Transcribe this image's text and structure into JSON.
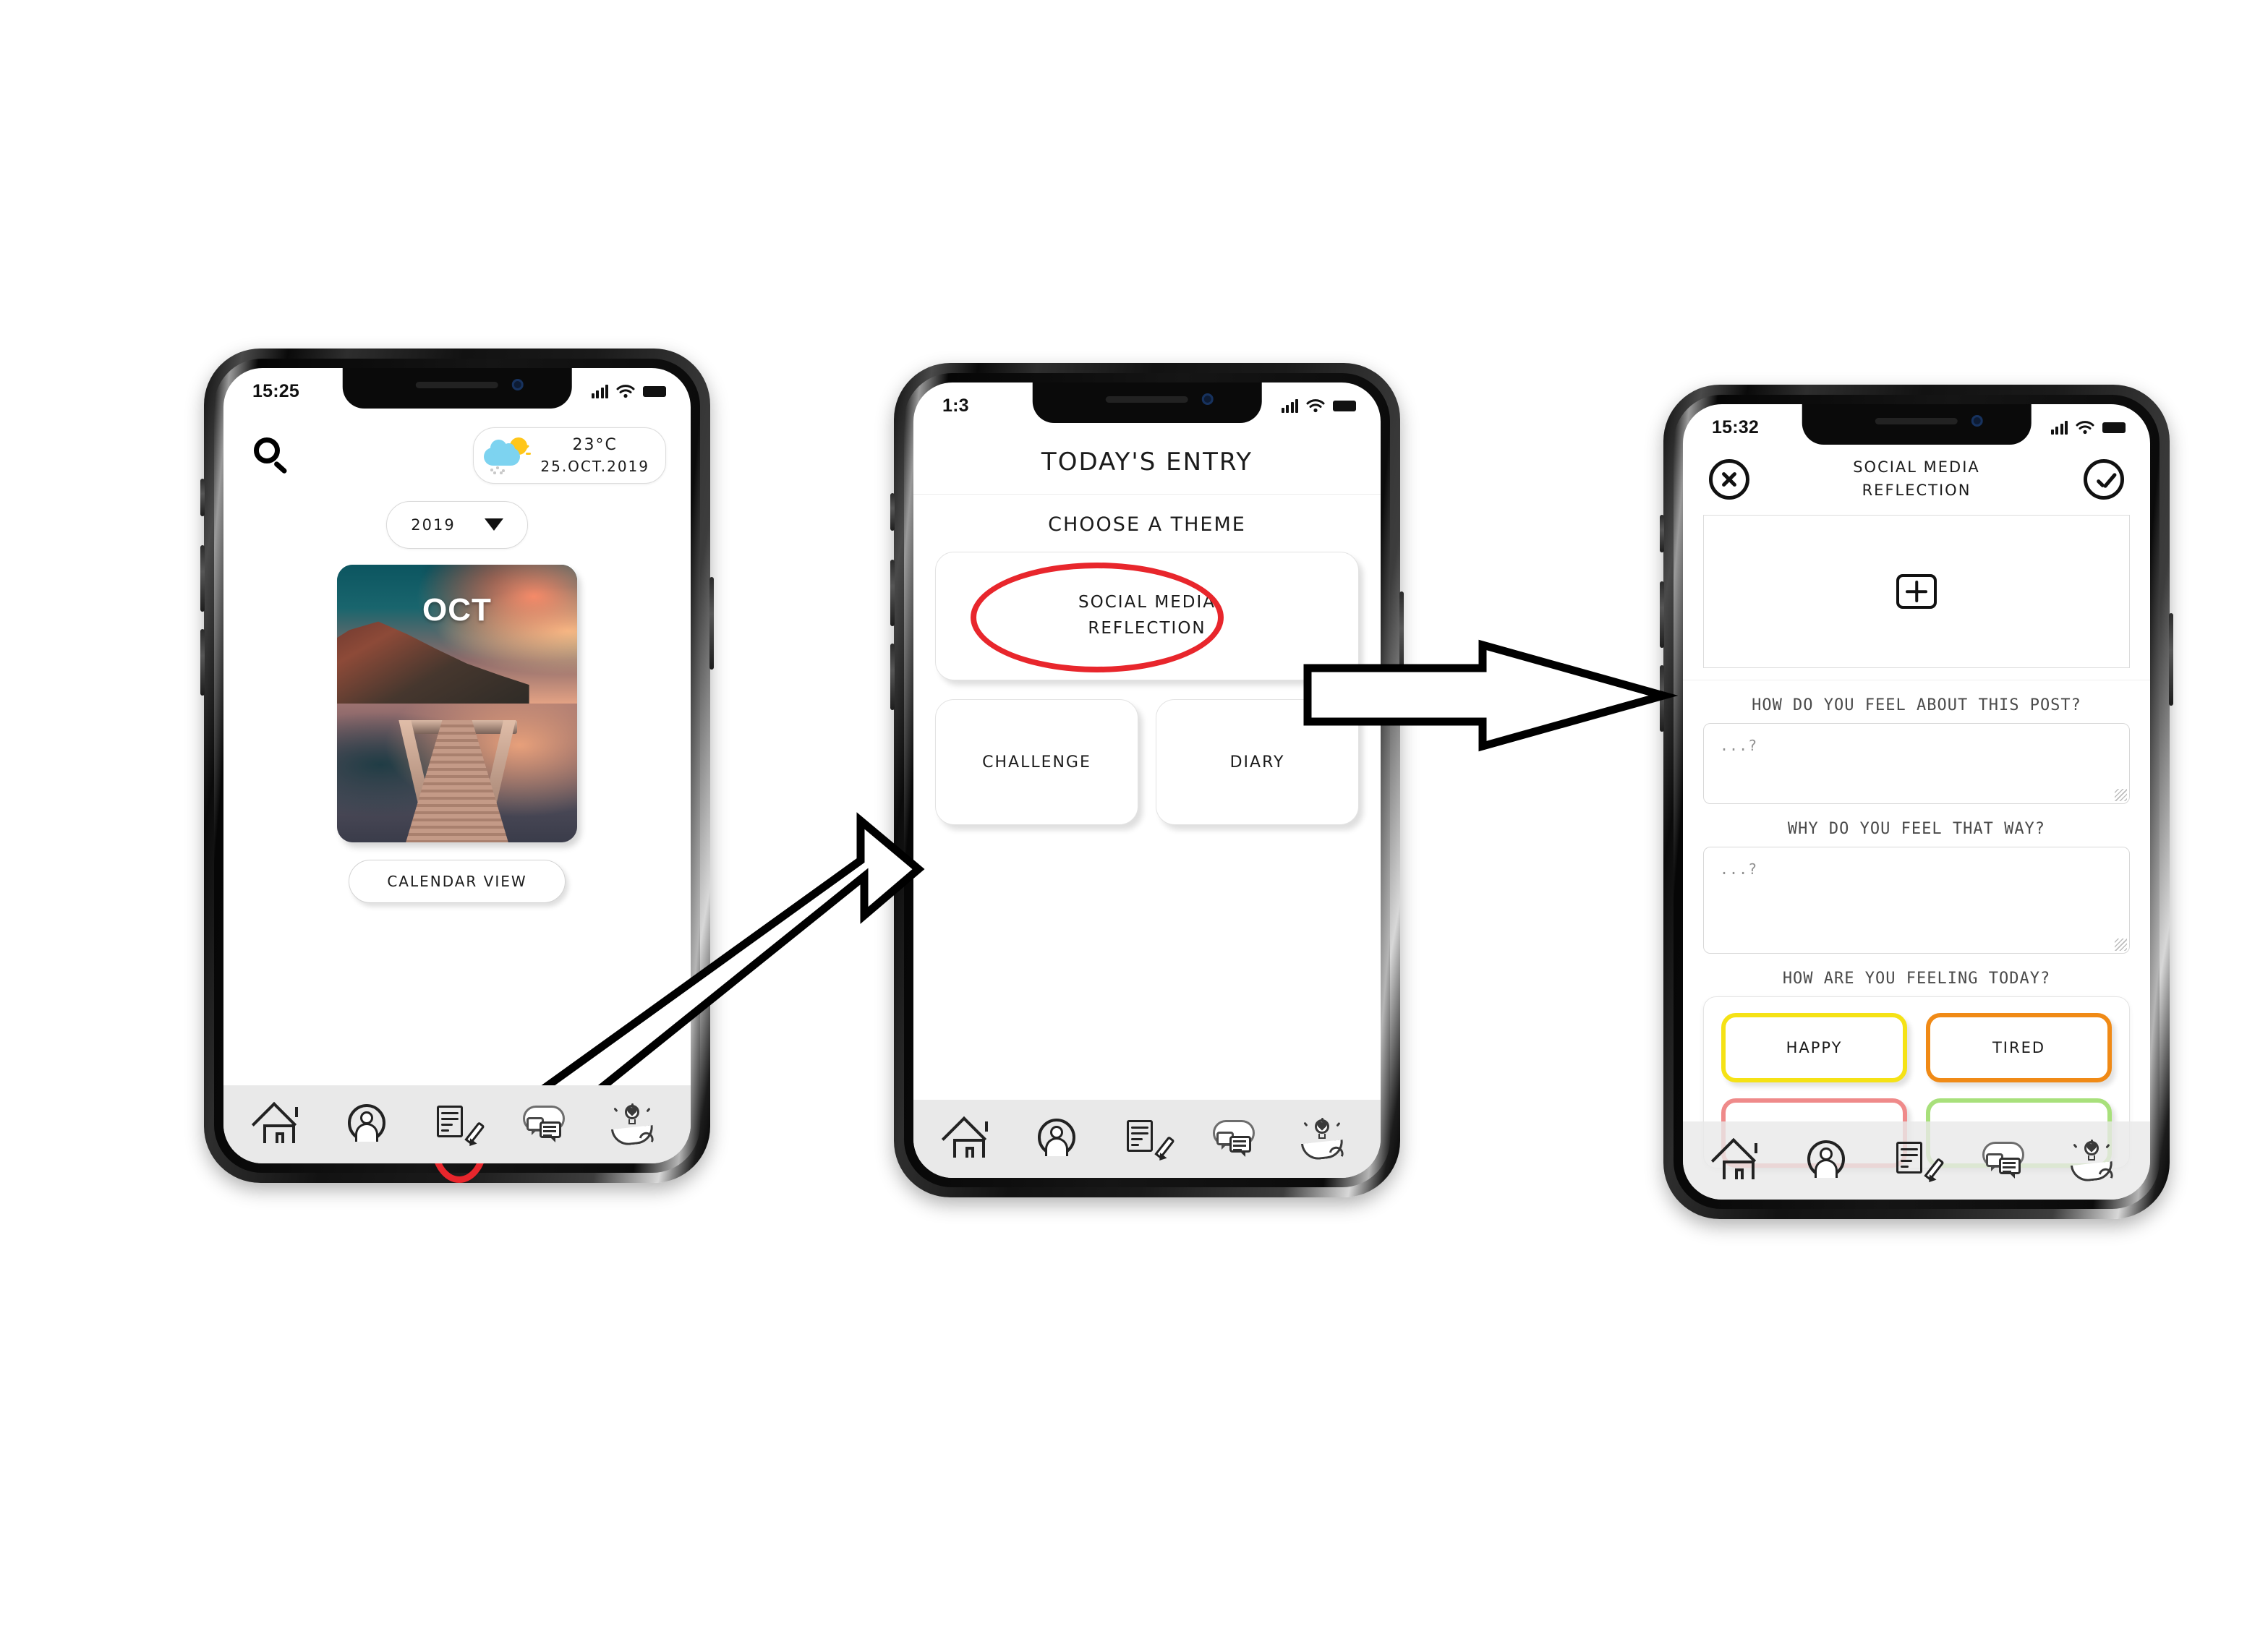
{
  "screens": [
    {
      "id": "home",
      "status": {
        "time": "15:25",
        "signal_icon": "signal-bars-icon",
        "wifi_icon": "wifi-icon",
        "battery_icon": "battery-icon"
      },
      "search_icon": "search-icon",
      "weather": {
        "icon": "sun-cloud-drizzle-icon",
        "temperature": "23°C",
        "date": "25.OCT.2019"
      },
      "year_select": {
        "value": "2019",
        "caret_icon": "chevron-down-icon"
      },
      "month_card": {
        "label": "OCT"
      },
      "calendar_button": "CALENDAR VIEW",
      "nav": [
        {
          "name": "home",
          "icon": "home-icon",
          "highlighted": false
        },
        {
          "name": "profile",
          "icon": "profile-circle-icon",
          "highlighted": false
        },
        {
          "name": "entry",
          "icon": "note-pencil-icon",
          "highlighted": true
        },
        {
          "name": "community",
          "icon": "chat-cloud-icon",
          "highlighted": false
        },
        {
          "name": "support",
          "icon": "hand-lightbulb-icon",
          "highlighted": false
        }
      ]
    },
    {
      "id": "todays-entry",
      "status": {
        "time": "1:3",
        "signal_icon": "signal-bars-icon",
        "wifi_icon": "wifi-icon",
        "battery_icon": "battery-icon"
      },
      "title": "TODAY'S ENTRY",
      "subtitle": "CHOOSE A THEME",
      "themes": [
        {
          "label_line1": "SOCIAL MEDIA",
          "label_line2": "REFLECTION",
          "highlighted": true
        },
        {
          "label": "CHALLENGE",
          "highlighted": false
        },
        {
          "label": "DIARY",
          "highlighted": false
        }
      ],
      "nav": [
        {
          "name": "home",
          "icon": "home-icon"
        },
        {
          "name": "profile",
          "icon": "profile-circle-icon"
        },
        {
          "name": "entry",
          "icon": "note-pencil-icon"
        },
        {
          "name": "community",
          "icon": "chat-cloud-icon"
        },
        {
          "name": "support",
          "icon": "hand-lightbulb-icon"
        }
      ]
    },
    {
      "id": "social-media-reflection",
      "status": {
        "time": "15:32",
        "signal_icon": "signal-bars-icon",
        "wifi_icon": "wifi-icon",
        "battery_icon": "battery-icon"
      },
      "close_icon": "close-circle-icon",
      "confirm_icon": "check-circle-icon",
      "title_line1": "SOCIAL MEDIA",
      "title_line2": "REFLECTION",
      "photo_upload": {
        "icon": "plus-square-icon"
      },
      "questions": [
        {
          "label": "HOW DO YOU FEEL ABOUT THIS POST?",
          "placeholder": "...?"
        },
        {
          "label": "WHY DO YOU FEEL THAT WAY?",
          "placeholder": "...?"
        }
      ],
      "mood_label": "HOW ARE YOU FEELING TODAY?",
      "moods": [
        {
          "label": "HAPPY",
          "color": "#f5e215"
        },
        {
          "label": "TIRED",
          "color": "#f08a16"
        },
        {
          "label": "",
          "color": "#ef8a8a"
        },
        {
          "label": "",
          "color": "#a8e07b"
        }
      ],
      "nav": [
        {
          "name": "home",
          "icon": "home-icon"
        },
        {
          "name": "profile",
          "icon": "profile-circle-icon"
        },
        {
          "name": "entry",
          "icon": "note-pencil-icon"
        },
        {
          "name": "community",
          "icon": "chat-cloud-icon"
        },
        {
          "name": "support",
          "icon": "hand-lightbulb-icon"
        }
      ]
    }
  ],
  "annotations": {
    "highlight_color": "#e8262c",
    "arrows": [
      {
        "name": "arrow-entry-to-theme",
        "direction": "up-right"
      },
      {
        "name": "arrow-theme-to-reflection",
        "direction": "right"
      }
    ]
  }
}
